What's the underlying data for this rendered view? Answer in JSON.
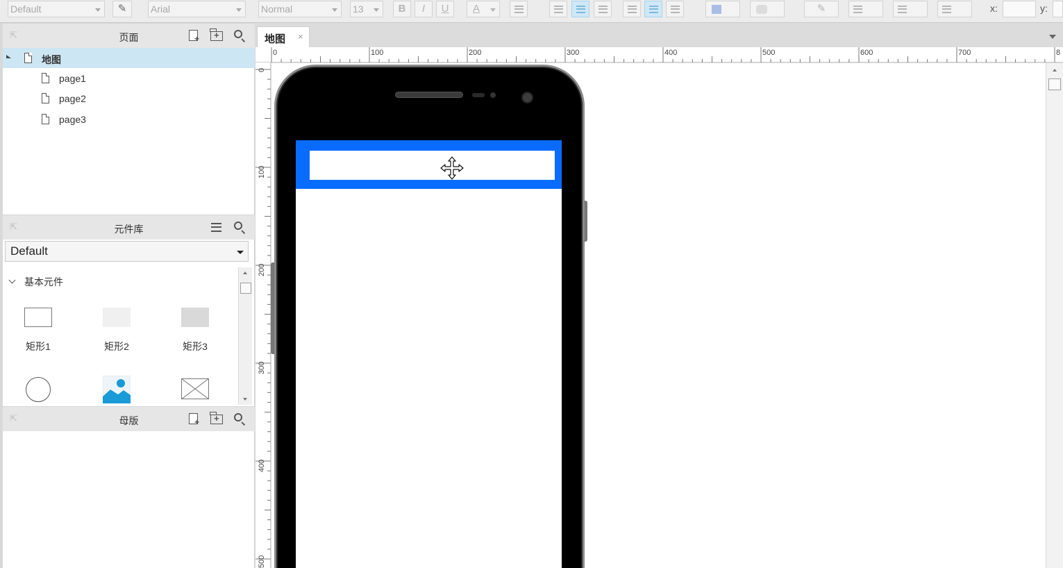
{
  "toolbar": {
    "style_select": "Default",
    "font_family": "Arial",
    "font_weight": "Normal",
    "font_size": "13",
    "bold": "B",
    "italic": "I",
    "underline": "U",
    "font_color_icon": "A",
    "x_label": "x:",
    "y_label": "y:"
  },
  "pages_panel": {
    "title": "页面",
    "root": "地图",
    "children": [
      "page1",
      "page2",
      "page3"
    ]
  },
  "library_panel": {
    "title": "元件库",
    "library_select": "Default",
    "group": "基本元件",
    "widgets": [
      "矩形1",
      "矩形2",
      "矩形3"
    ]
  },
  "masters_panel": {
    "title": "母版"
  },
  "canvas": {
    "tab_label": "地图",
    "tab_close": "×",
    "h_ruler": [
      "0",
      "100",
      "200",
      "300",
      "400",
      "500",
      "600",
      "700",
      "8"
    ],
    "v_ruler": [
      "0",
      "100",
      "200",
      "300",
      "400",
      "500"
    ]
  },
  "colors": {
    "header_blue": "#0a6cff",
    "selection": "#cde6f4"
  }
}
